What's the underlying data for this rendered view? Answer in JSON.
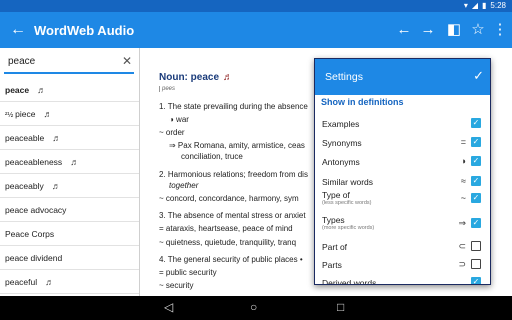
{
  "status": {
    "time": "5:28"
  },
  "appbar": {
    "title": "WordWeb Audio"
  },
  "search": {
    "query": "peace"
  },
  "word_list": [
    {
      "word": "peace",
      "bold": true,
      "audio": "♬"
    },
    {
      "word": "piece",
      "bold": false,
      "audio": "♬",
      "sound_alike": "²½"
    },
    {
      "word": "peaceable",
      "bold": false,
      "audio": "♬"
    },
    {
      "word": "peaceableness",
      "bold": false,
      "audio": "♬"
    },
    {
      "word": "peaceably",
      "bold": false,
      "audio": "♬"
    },
    {
      "word": "peace advocacy",
      "bold": false
    },
    {
      "word": "Peace Corps",
      "bold": false
    },
    {
      "word": "peace dividend",
      "bold": false
    },
    {
      "word": "peaceful",
      "bold": false,
      "audio": "♬"
    }
  ],
  "entry": {
    "pos_label": "Noun: peace",
    "audio": "♬",
    "pronunciation": "pees",
    "lines": [
      {
        "text": "1. The state prevailing during the absence",
        "italic": false
      },
      {
        "text": "◑ war",
        "italic": false
      },
      {
        "text": "~  order",
        "italic": false
      },
      {
        "text": "⇒  Pax Romana, amity, armistice, ceas",
        "italic": false
      },
      {
        "text": "conciliation, truce",
        "italic": false
      },
      {
        "text": "2. Harmonious relations; freedom from dis",
        "italic": false
      },
      {
        "text": "together",
        "italic": true
      },
      {
        "text": "~  concord, concordance, harmony, sym",
        "italic": false
      },
      {
        "text": "3. The absence of mental stress or anxiet",
        "italic": false
      },
      {
        "text": "=  ataraxis, heartsease, peace of mind",
        "italic": false
      },
      {
        "text": "~  quietness, quietude, tranquility, tranq",
        "italic": false
      },
      {
        "text": "4. The general security of public places •",
        "italic": false
      },
      {
        "text": "=  public security",
        "italic": false
      },
      {
        "text": "~  security",
        "italic": false
      }
    ]
  },
  "settings": {
    "title": "Settings",
    "section": "Show in definitions",
    "rows": [
      {
        "label": "Examples",
        "sub": "",
        "symbol": "",
        "checked": true
      },
      {
        "label": "Synonyms",
        "sub": "",
        "symbol": "=",
        "checked": true
      },
      {
        "label": "Antonyms",
        "sub": "",
        "symbol": "◑",
        "checked": true
      },
      {
        "label": "Similar words",
        "sub": "",
        "symbol": "≈",
        "checked": true
      },
      {
        "label": "Type of",
        "sub": "(less specific words)",
        "symbol": "~",
        "checked": true
      },
      {
        "label": "Types",
        "sub": "(more specific words)",
        "symbol": "⇒",
        "checked": true
      },
      {
        "label": "Part of",
        "sub": "",
        "symbol": "⊂",
        "checked": false
      },
      {
        "label": "Parts",
        "sub": "",
        "symbol": "⊃",
        "checked": false
      },
      {
        "label": "Derived words",
        "sub": "",
        "symbol": "",
        "checked": true
      }
    ]
  },
  "colors": {
    "appbar": "#1e88e5",
    "statusbar": "#1565c0",
    "accent": "#29a8e0"
  }
}
